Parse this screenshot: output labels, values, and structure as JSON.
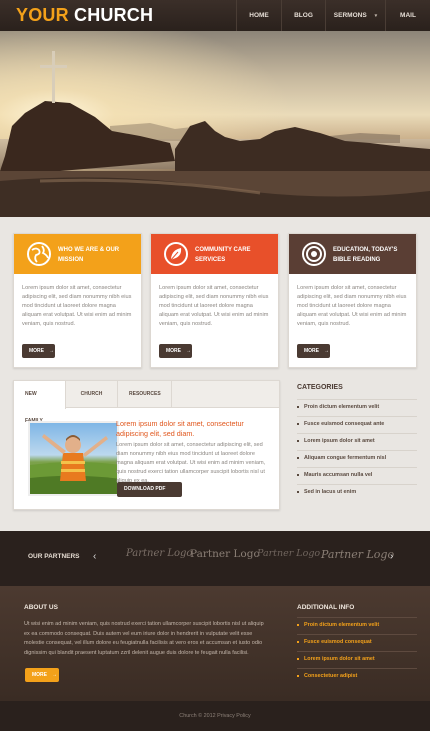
{
  "header": {
    "logo_part1": "YOUR",
    "logo_part2": "CHURCH",
    "nav": [
      {
        "label": "HOME"
      },
      {
        "label": "BLOG"
      },
      {
        "label": "SERMONS"
      },
      {
        "label": "MAIL"
      }
    ]
  },
  "slider": {
    "dot_count": 4,
    "active_dot": 1
  },
  "features": [
    {
      "title": "WHO WE ARE & OUR MISSION",
      "icon": "globe-icon",
      "color": "#f3a11a",
      "text": "Lorem ipsum dolor sit amet, consectetur adipiscing elit, sed diam nonummy nibh eius mod tincidunt ut laoreet dolore magna aliquam erat volutpat. Ut wisi enim ad minim veniam, quis nostrud.",
      "button": "MORE"
    },
    {
      "title": "COMMUNITY CARE SERVICES",
      "icon": "leaf-icon",
      "color": "#e8502a",
      "text": "Lorem ipsum dolor sit amet, consectetur adipiscing elit, sed diam nonummy nibh eius mod tincidunt ut laoreet dolore magna aliquam erat volutpat. Ut wisi enim ad minim veniam, quis nostrud.",
      "button": "MORE"
    },
    {
      "title": "EDUCATION, TODAY'S BIBLE READING",
      "icon": "target-icon",
      "color": "#5a3e34",
      "text": "Lorem ipsum dolor sit amet, consectetur adipiscing elit, sed diam nonummy nibh eius mod tincidunt ut laoreet dolore magna aliquam erat volutpat. Ut wisi enim ad minim veniam, quis nostrud.",
      "button": "MORE"
    }
  ],
  "tabs": {
    "labels": [
      "NEW FAMILY",
      "CHURCH",
      "RESOURCES"
    ],
    "active": 0,
    "heading": "Lorem ipsum dolor sit amet, consectetur adipiscing elit, sed diam.",
    "text": "Lorem ipsum dolor sit amet, consectetur adipiscing elit, sed diam nonummy nibh eius mod tincidunt ut laoreet dolore magna aliquam erat volutpat. Ut wisi enim ad minim veniam, quis nostrud exerci tation ullamcorper suscipit lobortis nisl ut aliquip ex ea.",
    "button": "DOWNLOAD PDF FILE"
  },
  "categories": {
    "title": "CATEGORIES",
    "items": [
      "Proin dictum elementum velit",
      "Fusce euismod consequat ante",
      "Lorem ipsum dolor sit amet",
      "Aliquam congue fermentum nisl",
      "Mauris accumsan nulla vel",
      "Sed in lacus ut enim"
    ]
  },
  "partners": {
    "title": "OUR PARTNERS",
    "logos": [
      "Partner Logo",
      "Partner Logo",
      "Partner Logo",
      "Partner Logo"
    ]
  },
  "about": {
    "title": "ABOUT US",
    "text": "Ut wisi enim ad minim veniam, quis nostrud exerci tation ullamcorper suscipit lobortis nisl ut aliquip ex ea commodo consequat. Duis autem vel eum iriure dolor in hendrerit in vulputate velit esse molestie consequat, vel illum dolore eu feugiatnulla facilisis at vero eros et accumsan et iusto odio dignissim qui blandit praesent luptatum zzril delenit augue duis dolore te feugait nulla facilisi.",
    "button": "MORE"
  },
  "additional": {
    "title": "ADDITIONAL INFO",
    "items": [
      "Proin dictum elementum velit",
      "Fusce euismod consequat",
      "Lorem ipsum dolor sit amet",
      "Consectetuer adipist"
    ]
  },
  "footer": {
    "text": "Church © 2012 Privacy Policy"
  }
}
